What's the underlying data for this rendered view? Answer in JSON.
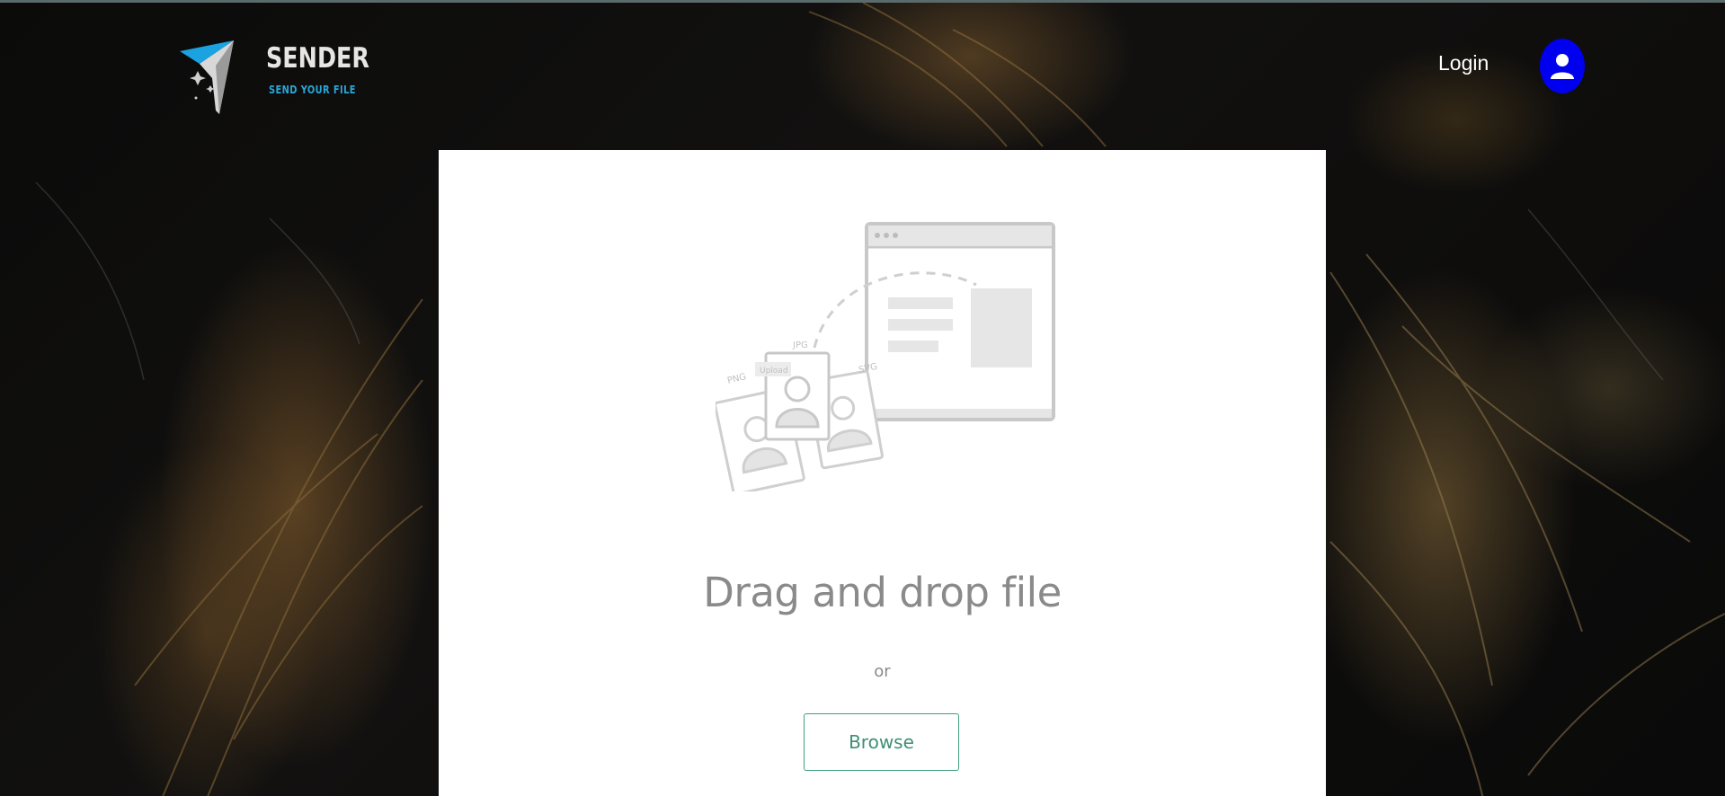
{
  "header": {
    "brand_title": "SENDER",
    "brand_tagline": "SEND YOUR FILE",
    "login_label": "Login",
    "accent_color": "#2aa6d9",
    "avatar_color": "#0000ee"
  },
  "upload": {
    "illustration_labels": {
      "left_file": "PNG",
      "center_file": "JPG",
      "right_file": "SVG",
      "upload_tag": "Upload"
    },
    "title": "Drag and drop file",
    "separator": "or",
    "browse_label": "Browse",
    "button_color": "#3f9f7f"
  },
  "icons": {
    "logo": "paper-plane-logo",
    "avatar": "user-icon",
    "illustration": "file-upload-illustration"
  }
}
